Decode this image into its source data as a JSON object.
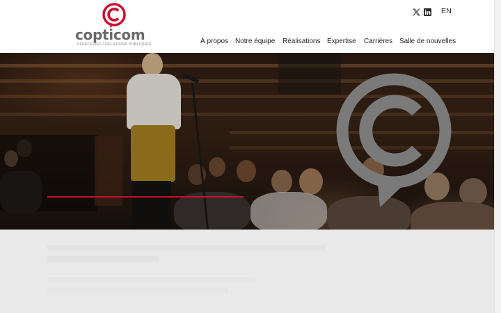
{
  "brand": {
    "name": "copticom",
    "tagline": "STRATÉGIES / RELATIONS PUBLIQUES",
    "accent_color": "#c8102e",
    "gray_color": "#7a7a7a"
  },
  "header": {
    "social": [
      {
        "icon": "x-twitter-icon"
      },
      {
        "icon": "linkedin-icon"
      }
    ],
    "language": "EN"
  },
  "nav": {
    "items": [
      {
        "label": "À propos"
      },
      {
        "label": "Notre équipe"
      },
      {
        "label": "Réalisations"
      },
      {
        "label": "Expertise"
      },
      {
        "label": "Carrières"
      },
      {
        "label": "Salle de nouvelles"
      }
    ]
  },
  "hero": {
    "image": "conference-audience-speaker-photo",
    "overlay_logo": "copticom-speech-bubble-logo"
  }
}
